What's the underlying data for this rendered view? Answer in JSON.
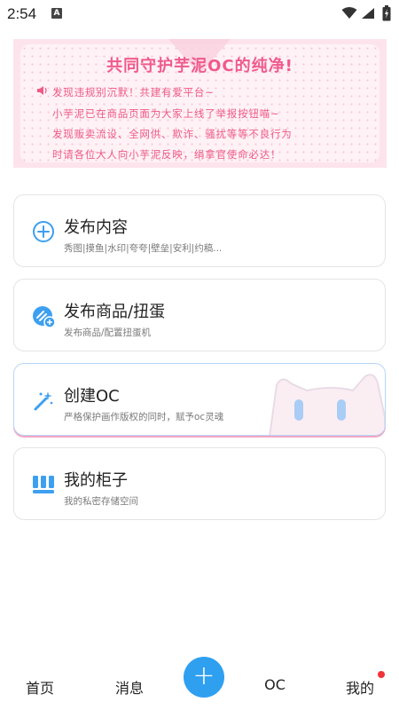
{
  "status_bar": {
    "time": "2:54",
    "notification_icon": "A"
  },
  "banner": {
    "title": "共同守护芋泥OC的纯净!",
    "lines": [
      "发现违规别沉默！共建有爱平台~",
      "小芋泥已在商品页面为大家上线了举报按钮喵~",
      "发现贩卖流设、全网供、欺诈、骚扰等等不良行为",
      "时请各位大人向小芋泥反映，绢拿官使命必达！"
    ]
  },
  "cards": [
    {
      "title": "发布内容",
      "subtitle": "秀图|摸鱼|水印|夸夸|壁垒|安利|约稿...",
      "icon": "plus-circle-icon"
    },
    {
      "title": "发布商品/扭蛋",
      "subtitle": "发布商品/配置扭蛋机",
      "icon": "product-add-icon"
    },
    {
      "title": "创建OC",
      "subtitle": "严格保护画作版权的同时，赋予oc灵魂",
      "icon": "magic-wand-icon"
    },
    {
      "title": "我的柜子",
      "subtitle": "我的私密存储空间",
      "icon": "cabinet-icon"
    }
  ],
  "tabbar": {
    "home": "首页",
    "messages": "消息",
    "plus": "+",
    "oc": "OC",
    "me": "我的"
  },
  "colors": {
    "accent_blue": "#2f9ff0",
    "banner_pink": "#f05a8c",
    "badge_red": "#f0333a"
  }
}
